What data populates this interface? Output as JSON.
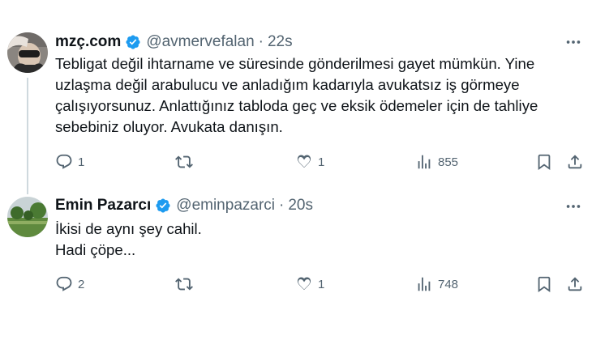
{
  "tweets": [
    {
      "name": "mzç.com",
      "handle": "@avmervefalan",
      "separator": "·",
      "time": "22s",
      "text_lines": [
        "Tebligat değil ihtarname ve süresinde gönderilmesi gayet mümkün. Yine",
        "uzlaşma değil arabulucu ve anladığım kadarıyla avukatsız iş görmeye",
        "çalışıyorsunuz. Anlattığınız tabloda geç ve eksik ödemeler için de tahliye",
        "sebebiniz oluyor. Avukata danışın."
      ],
      "replies": "1",
      "retweets": "",
      "likes": "1",
      "views": "855"
    },
    {
      "name": "Emin Pazarcı",
      "handle": "@eminpazarci",
      "separator": "·",
      "time": "20s",
      "text_lines": [
        "İkisi de aynı şey cahil.",
        "Hadi çöpe..."
      ],
      "replies": "2",
      "retweets": "",
      "likes": "1",
      "views": "748"
    }
  ],
  "colors": {
    "verified": "#1d9bf0",
    "secondary_text": "#536471",
    "primary_text": "#0f1419",
    "thread_line": "#cfd9de"
  },
  "icons": [
    "more-icon",
    "verified-badge-icon",
    "reply-icon",
    "retweet-icon",
    "like-icon",
    "views-icon",
    "bookmark-icon",
    "share-icon"
  ]
}
